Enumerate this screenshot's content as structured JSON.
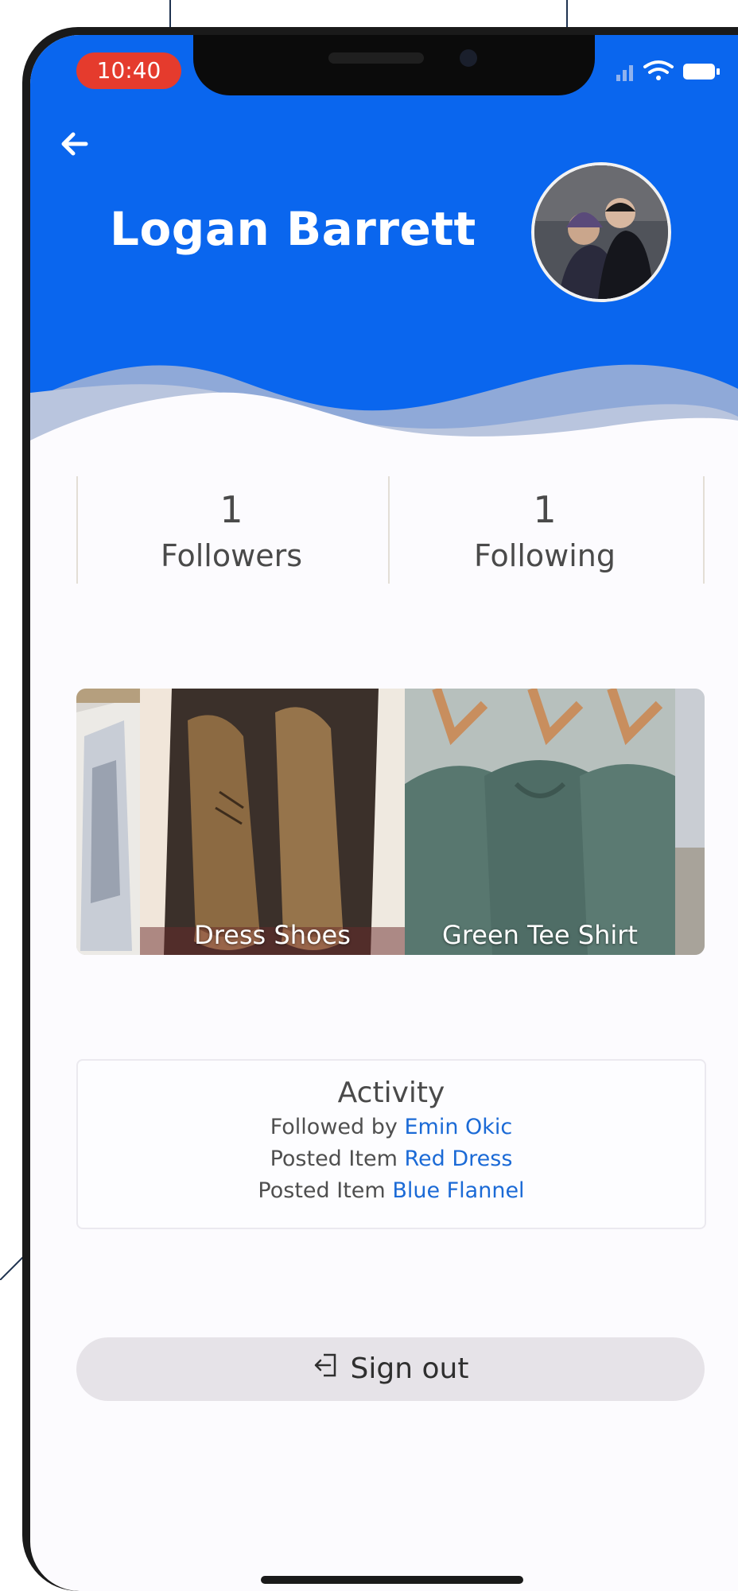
{
  "status_bar": {
    "time": "10:40"
  },
  "profile": {
    "name": "Logan Barrett"
  },
  "stats": [
    {
      "count": "1",
      "label": "Followers"
    },
    {
      "count": "1",
      "label": "Following"
    }
  ],
  "carousel": {
    "items": [
      {
        "caption": "Dress Shoes"
      },
      {
        "caption": "Green Tee Shirt"
      }
    ]
  },
  "activity": {
    "title": "Activity",
    "entries": [
      {
        "prefix": "Followed by",
        "link": "Emin Okic"
      },
      {
        "prefix": "Posted Item",
        "link": "Red Dress"
      },
      {
        "prefix": "Posted Item",
        "link": "Blue Flannel"
      }
    ]
  },
  "signout": {
    "label": "Sign out"
  },
  "colors": {
    "header": "#0a66ee",
    "link": "#1b6ad6",
    "time_pill": "#e53b2d"
  }
}
